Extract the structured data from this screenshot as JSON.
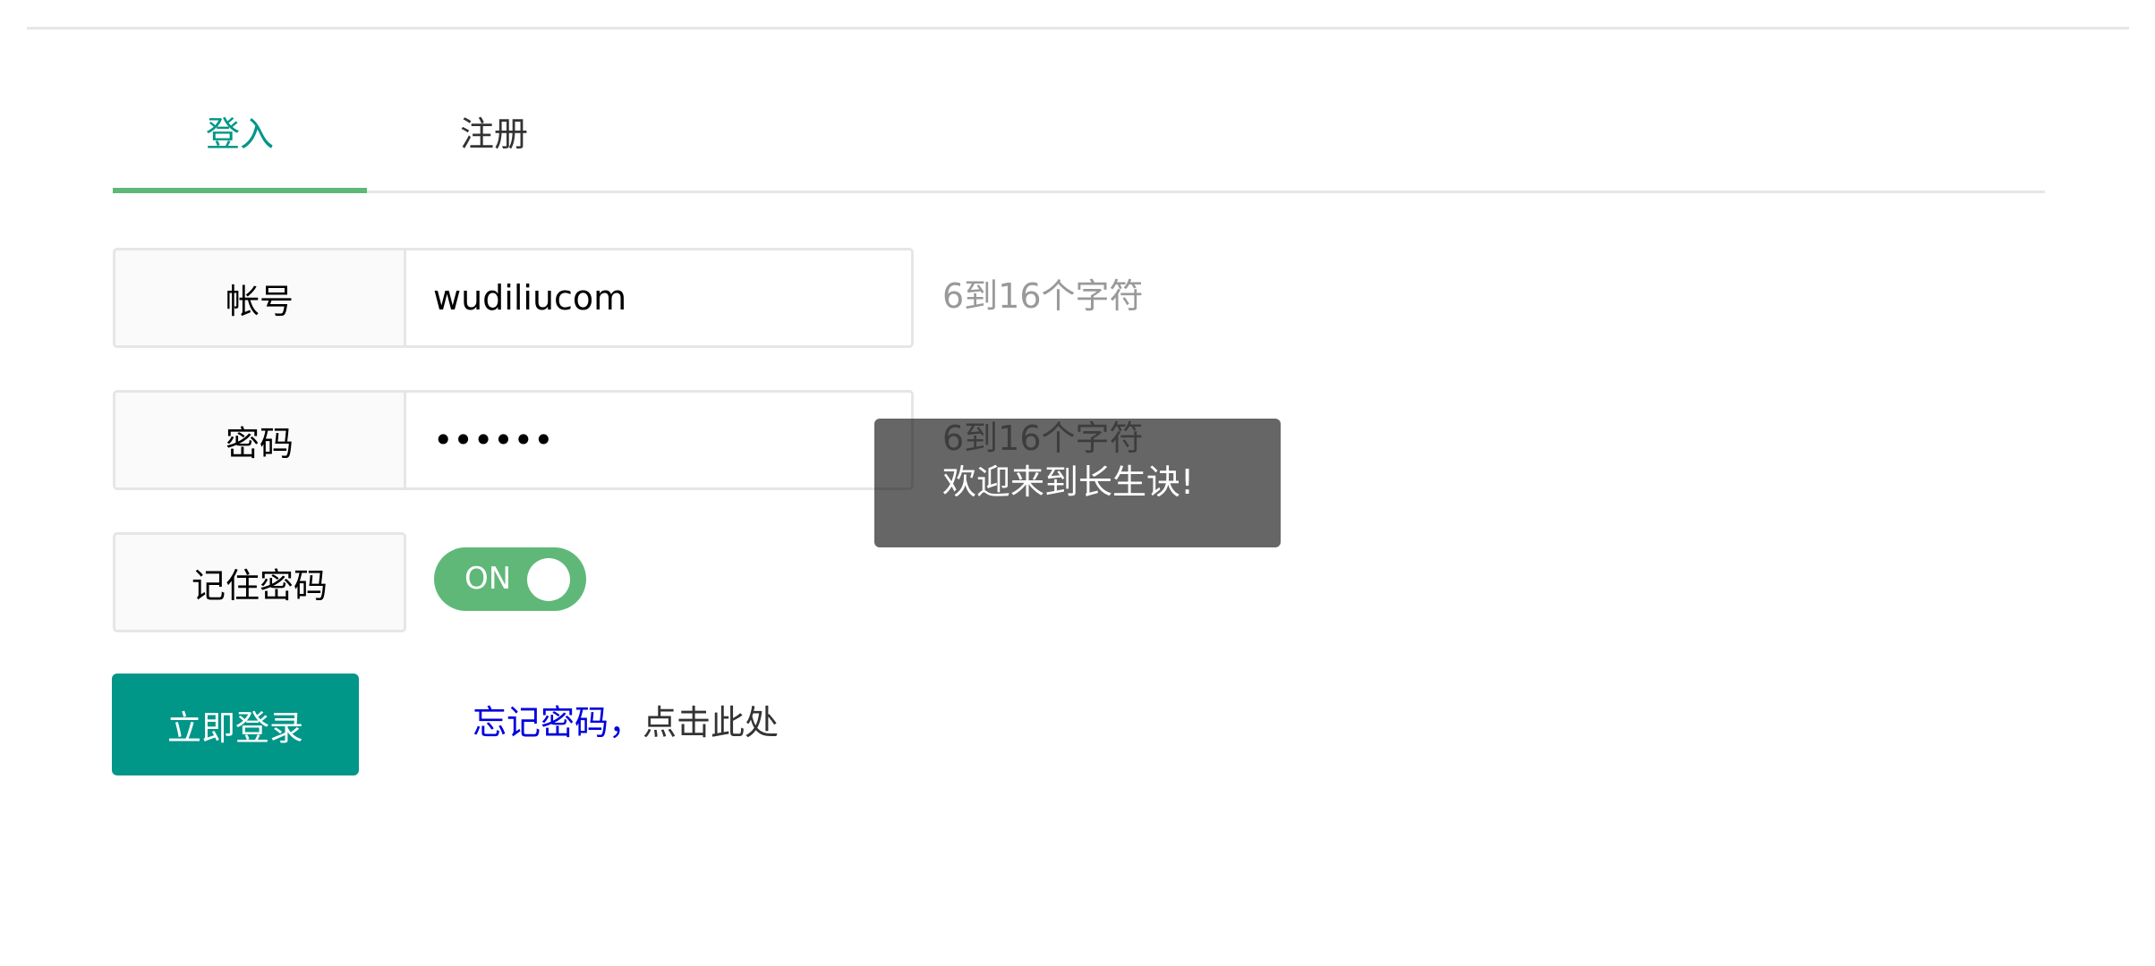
{
  "tabs": [
    {
      "label": "登入",
      "active": true
    },
    {
      "label": "注册",
      "active": false
    }
  ],
  "form": {
    "account": {
      "label": "帐号",
      "value": "wudiliucom",
      "hint": "6到16个字符"
    },
    "password": {
      "label": "密码",
      "value": "••••••",
      "hint": "6到16个字符"
    },
    "remember": {
      "label": "记住密码",
      "toggle_text": "ON",
      "checked": true
    },
    "submit_label": "立即登录",
    "forgot": {
      "link_text": "忘记密码，",
      "rest_text": "点击此处"
    }
  },
  "toast": {
    "message": "欢迎来到长生诀!"
  },
  "colors": {
    "primary": "#009688",
    "accent_green": "#5fb878",
    "link_blue": "#0000dd",
    "hint_gray": "#999999",
    "border": "#e6e6e6"
  }
}
